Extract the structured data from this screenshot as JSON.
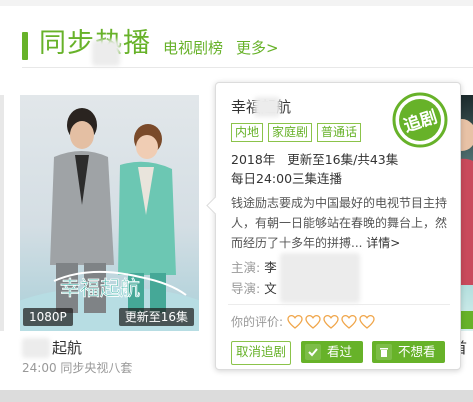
{
  "section": {
    "title": "同步热播",
    "links": [
      "电视剧榜",
      "更多>"
    ]
  },
  "card": {
    "badge_quality": "1080P",
    "badge_episodes": "更新至16集",
    "name": "起航",
    "sub": "24:00 同步央视八套",
    "poster_logo": "幸福起航"
  },
  "right_card": {
    "name": "首"
  },
  "popup": {
    "title": "幸福起航",
    "tags": [
      "内地",
      "家庭剧",
      "普通话"
    ],
    "year_line": "2018年",
    "update_line": "更新至16集/共43集",
    "schedule": "每日24:00三集连播",
    "description": "钱途励志要成为中国最好的电视节目主持人，有朝一日能够站在春晚的舞台上，然而经历了十多年的拼搏...",
    "detail_link": "详情>",
    "cast_label": "主演:",
    "cast_value": "李",
    "director_label": "导演:",
    "director_value": "文",
    "rating_label": "你的评价:",
    "rating_max": 5,
    "rating_value": 0,
    "stamp_text": "追剧",
    "buttons": {
      "cancel_follow": "取消追剧",
      "watched": "看过",
      "not_interested": "不想看"
    }
  },
  "colors": {
    "accent": "#67b229",
    "heart": "#f0a64b"
  }
}
